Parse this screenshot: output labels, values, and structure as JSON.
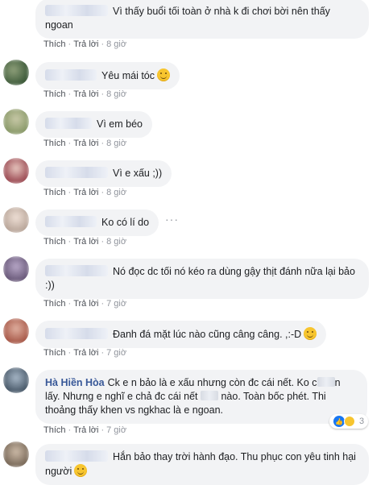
{
  "comments": [
    {
      "id": "c1",
      "text": "Vì thấy buổi tối toàn ở nhà k đi chơi bời nên thấy ngoan",
      "emoji": "",
      "time": "8 giờ",
      "avatar_color": "#5a6b7c"
    },
    {
      "id": "c2",
      "text": "Yêu mái tóc",
      "emoji": "smile-emoji",
      "time": "8 giờ",
      "avatar_color": "#3d5a3a"
    },
    {
      "id": "c3",
      "text": "Vì em béo",
      "emoji": "",
      "time": "8 giờ",
      "avatar_color": "#8a9a6a"
    },
    {
      "id": "c4",
      "text": "Vì e xấu ;))",
      "emoji": "",
      "time": "8 giờ",
      "avatar_color": "#a0525a"
    },
    {
      "id": "c5",
      "text": "Ko có lí do",
      "emoji": "",
      "time": "8 giờ",
      "avatar_color": "#b9a69a"
    },
    {
      "id": "c6",
      "text": "Nó đọc dc tối nó kéo ra dùng gậy thịt đánh nữa lại bảo :))",
      "emoji": "",
      "time": "7 giờ",
      "avatar_color": "#6a5a7a"
    },
    {
      "id": "c7",
      "text": "Đanh đá mặt lúc nào cũng câng câng. ,:-D",
      "emoji": "smile-emoji",
      "time": "7 giờ",
      "avatar_color": "#a85a4a"
    },
    {
      "id": "c8",
      "author": "Hà Hiền Hòa",
      "text_a": "Ck e n bảo là e xấu nhưng còn đc cái nết. Ko c",
      "text_b": "n lấy. Nhưng e nghĩ e chả đc cái nết",
      "text_c": "nào. Toàn bốc phét. Thi thoảng thấy khen vs ngkhac là e ngoan.",
      "time": "7 giờ",
      "reaction_count": "3",
      "avatar_color": "#4a5a6a"
    },
    {
      "id": "c9",
      "text": "Hắn bảo thay trời hành đạo. Thu phục con yêu tinh hại người",
      "emoji": "meh-emoji",
      "time": "",
      "avatar_color": "#7a6a5a"
    }
  ],
  "actions": {
    "like": "Thích",
    "reply": "Trả lời",
    "separator": "·"
  },
  "more_icon": "···"
}
